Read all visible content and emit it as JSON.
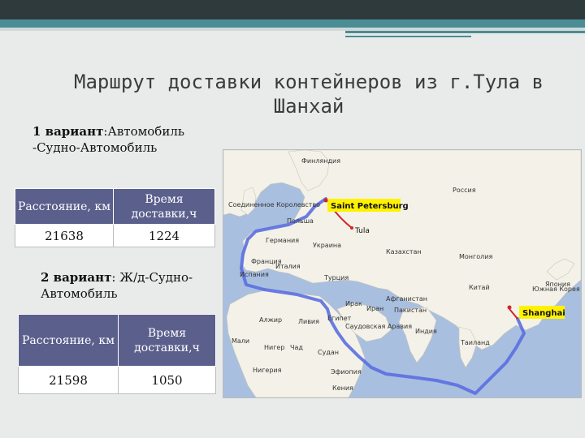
{
  "title": "Маршрут доставки контейнеров из г.Тула в Шанхай",
  "variant1": {
    "label_bold": "1 вариант",
    "label_text": ":Автомобиль -Судно-Автомобиль",
    "table": {
      "headers": [
        "Расстояние, км",
        "Время доставки,ч"
      ],
      "row": [
        "21638",
        "1224"
      ]
    }
  },
  "variant2": {
    "label_bold": "2 вариант",
    "label_text": ": Ж/д-Судно-Автомобиль",
    "table": {
      "headers": [
        "Расстояние, км",
        "Время доставки,ч"
      ],
      "row": [
        "21598",
        "1050"
      ]
    }
  },
  "map": {
    "callouts": {
      "saint_petersburg": "Saint Petersburg",
      "tula": "Tula",
      "shanghai": "Shanghai"
    },
    "countries": {
      "finland": "Финляндия",
      "russia": "Россия",
      "uk": "Соединенное Королевство",
      "poland": "Польша",
      "germany": "Германия",
      "ukraine": "Украина",
      "france": "Франция",
      "italy": "Италия",
      "kazakhstan": "Казахстан",
      "mongolia": "Монголия",
      "spain": "Испания",
      "turkey": "Турция",
      "china": "Китай",
      "south_korea": "Южная Корея",
      "japan": "Япония",
      "afghanistan": "Афганистан",
      "iraq": "Ирак",
      "iran": "Иран",
      "pakistan": "Пакистан",
      "algeria": "Алжир",
      "libya": "Ливия",
      "egypt": "Египет",
      "saudi_arabia": "Саудовская Аравия",
      "india": "Индия",
      "thailand": "Таиланд",
      "sudan": "Судан",
      "nigeria": "Нигерия",
      "ethiopia": "Эфиопия",
      "kenya": "Кения",
      "mali": "Мали",
      "niger": "Нигер",
      "chad": "Чад"
    }
  }
}
